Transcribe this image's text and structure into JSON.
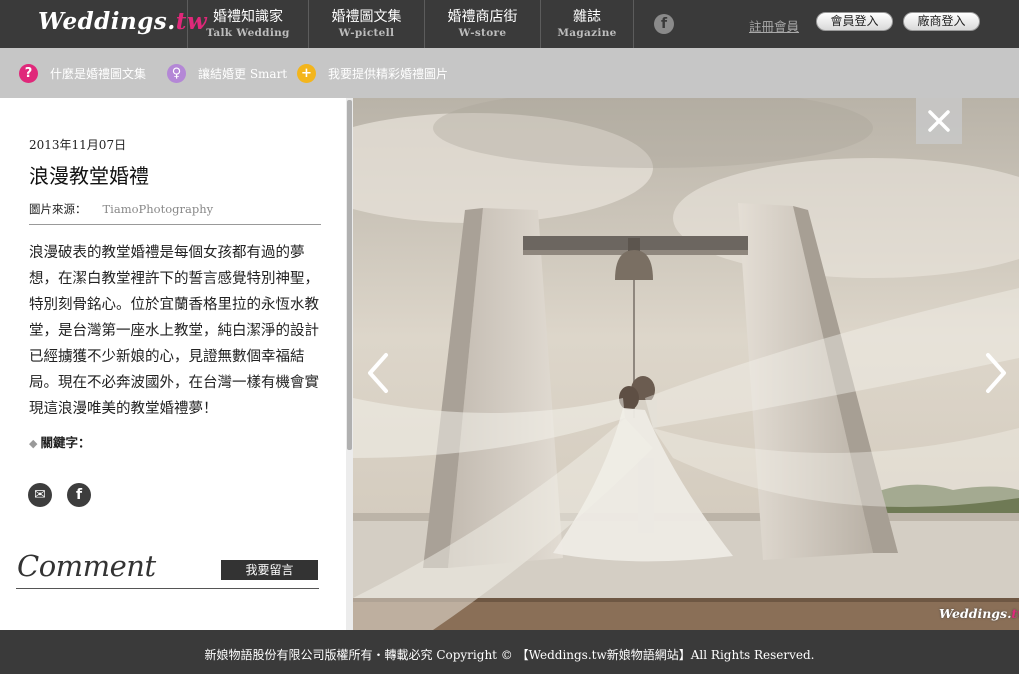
{
  "brand": {
    "logo_main": "Weddings.",
    "logo_tld": "tw"
  },
  "nav": [
    {
      "zh": "婚禮知識家",
      "en": "Talk Wedding"
    },
    {
      "zh": "婚禮圖文集",
      "en": "W-pictell"
    },
    {
      "zh": "婚禮商店街",
      "en": "W-store"
    },
    {
      "zh": "雜誌",
      "en": "Magazine"
    }
  ],
  "header": {
    "facebook_glyph": "f",
    "register_label": "註冊會員",
    "member_login_label": "會員登入",
    "vendor_login_label": "廠商登入"
  },
  "subnav": [
    {
      "icon": "question-icon",
      "glyph": "?",
      "color": "#e0287a",
      "label": "什麼是婚禮圖文集"
    },
    {
      "icon": "lightbulb-icon",
      "glyph": "♀",
      "color": "#b487d6",
      "label": "讓結婚更 Smart"
    },
    {
      "icon": "plus-icon",
      "glyph": "+",
      "color": "#f3b51c",
      "label": "我要提供精彩婚禮圖片"
    }
  ],
  "article": {
    "date": "2013年11月07日",
    "title": "浪漫教堂婚禮",
    "source_label": "圖片來源：",
    "source_value": "TiamoPhotography",
    "description": "浪漫破表的教堂婚禮是每個女孩都有過的夢想，在潔白教堂裡許下的誓言感覺特別神聖，特別刻骨銘心。位於宜蘭香格里拉的永恆水教堂，是台灣第一座水上教堂，純白潔淨的設計已經擄獲不少新娘的心，見證無數個幸福結局。現在不必奔波國外，在台灣一樣有機會實現這浪漫唯美的教堂婚禮夢！",
    "keywords_label": "關鍵字："
  },
  "share": {
    "email_glyph": "✉",
    "facebook_glyph": "f"
  },
  "comment": {
    "title": "Comment",
    "button_label": "我要留言"
  },
  "photo": {
    "watermark_main": "Weddings.",
    "watermark_tld": "tw"
  },
  "footer": {
    "text": "新娘物語股份有限公司版權所有・轉載必究 Copyright © 【Weddings.tw新娘物語網站】All Rights Reserved."
  },
  "colors": {
    "bar": "#3a3a3a",
    "subbar": "#c6c6c6",
    "accent": "#e0287a"
  }
}
